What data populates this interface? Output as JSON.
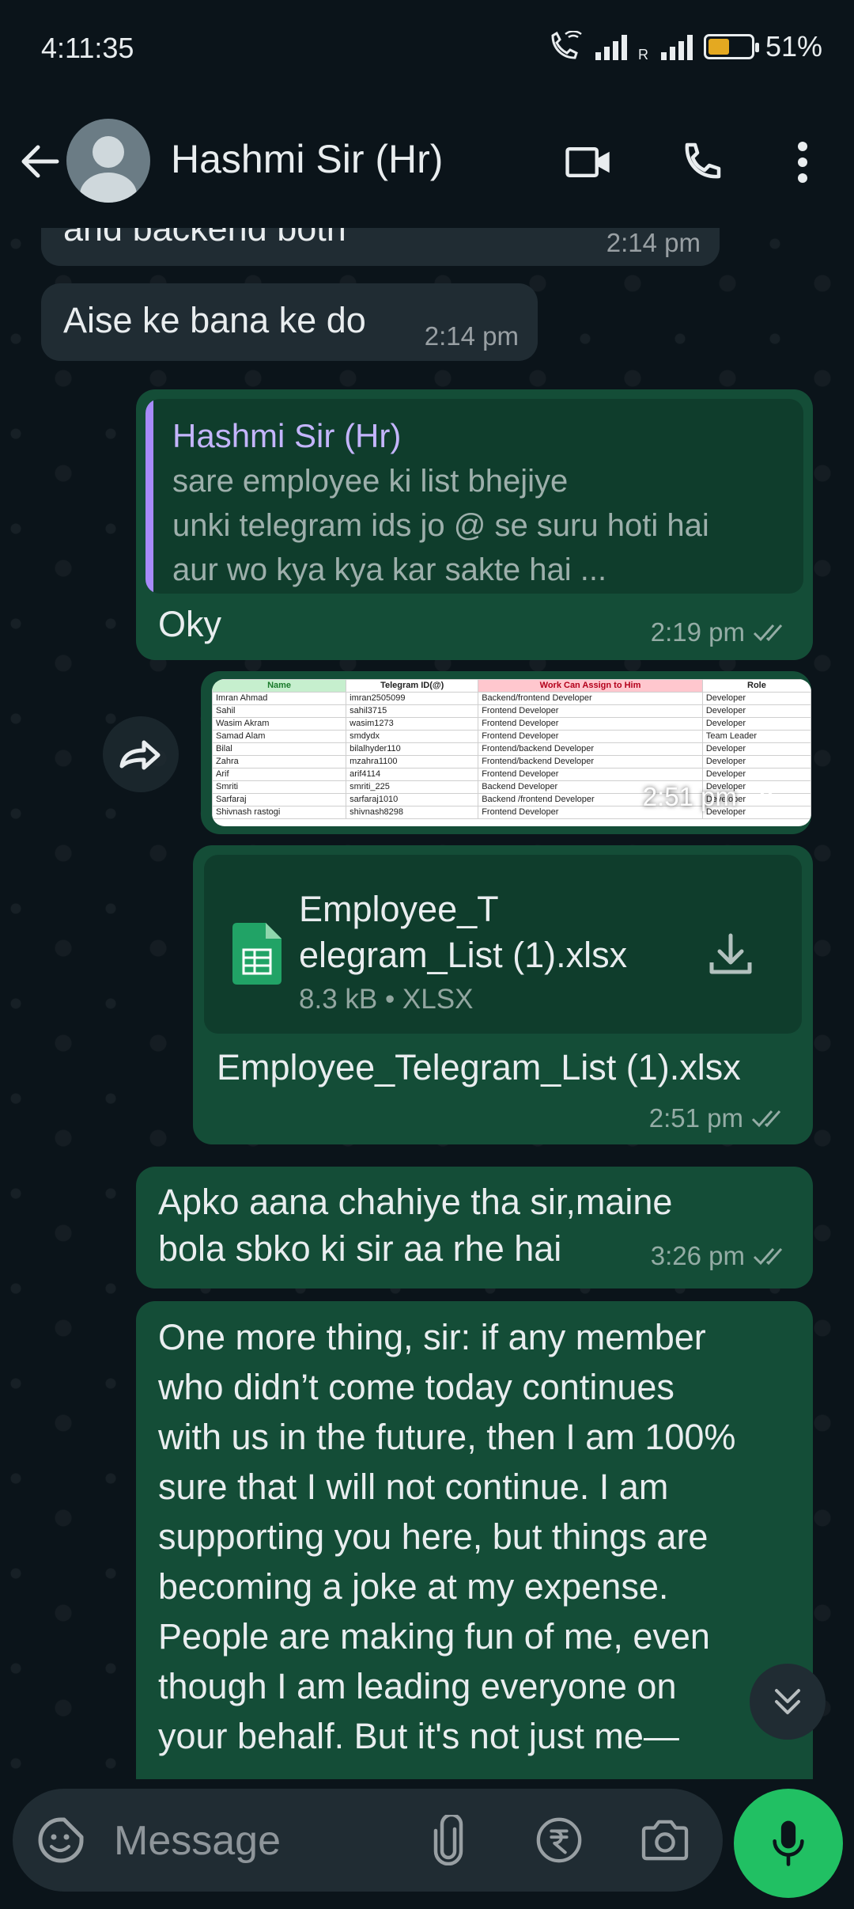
{
  "status_bar": {
    "time": "4:11:35",
    "battery": "51%",
    "roaming": "R",
    "battery_level": 0.51
  },
  "header": {
    "contact_name": "Hashmi Sir (Hr)"
  },
  "messages": {
    "m1": {
      "text": "and backend both",
      "time": "2:14 pm"
    },
    "m2": {
      "text": "Aise ke bana ke do",
      "time": "2:14 pm"
    },
    "m3": {
      "quote_name": "Hashmi Sir (Hr)",
      "quote_lines": [
        "sare employee ki list bhejiye",
        "unki telegram ids jo @ se suru hoti hai",
        "aur wo kya kya kar sakte hai ..."
      ],
      "text": "Oky",
      "time": "2:19 pm"
    },
    "m4": {
      "time": "2:51 pm"
    },
    "m5": {
      "file_name_line1": "Employee_T",
      "file_name_line2": "elegram_List (1).xlsx",
      "file_meta": "8.3 kB • XLSX",
      "caption": "Employee_Telegram_List (1).xlsx",
      "time": "2:51 pm"
    },
    "m6": {
      "line1": "Apko aana chahiye tha sir,maine",
      "line2": "bola sbko ki sir aa rhe hai",
      "time": "3:26 pm"
    },
    "m7": {
      "lines": [
        "One more thing, sir: if any member",
        "who didn’t come today continues",
        "with us in the future, then I am 100%",
        "sure that I will not continue. I am",
        "supporting you here, but things are",
        "becoming a joke at my expense.",
        "People are making fun of me, even",
        "though I am leading everyone on",
        "your behalf. But it's not just me—"
      ]
    }
  },
  "sheet": {
    "headers": [
      "Name",
      "Telegram ID(@)",
      "Work Can Assign to Him",
      "Role"
    ],
    "rows": [
      [
        "Imran Ahmad",
        "imran2505099",
        "Backend/frontend Developer",
        "Developer"
      ],
      [
        "Sahil",
        "sahil3715",
        "Frontend Developer",
        "Developer"
      ],
      [
        "Wasim Akram",
        "wasim1273",
        "Frontend Developer",
        "Developer"
      ],
      [
        "Samad Alam",
        "smdydx",
        "Frontend Developer",
        "Team Leader"
      ],
      [
        "Bilal",
        "bilalhyder110",
        "Frontend/backend Developer",
        "Developer"
      ],
      [
        "Zahra",
        "mzahra1100",
        "Frontend/backend Developer",
        "Developer"
      ],
      [
        "Arif",
        "arif4114",
        "Frontend Developer",
        "Developer"
      ],
      [
        "Smriti",
        "smriti_225",
        "Backend Developer",
        "Developer"
      ],
      [
        "Sarfaraj",
        "sarfaraj1010",
        "Backend /frontend Developer",
        "Developer"
      ],
      [
        "Shivnash rastogi",
        "shivnash8298",
        "Frontend Developer",
        "Developer"
      ]
    ]
  },
  "composer": {
    "placeholder": "Message"
  },
  "colors": {
    "background": "#0b141a",
    "incoming": "#202c33",
    "outgoing": "#144d37",
    "accent": "#21c063",
    "quote_bar": "#a78bfa"
  },
  "icons": [
    "back-arrow-icon",
    "avatar-icon",
    "video-call-icon",
    "phone-icon",
    "more-options-icon",
    "forward-icon",
    "spreadsheet-file-icon",
    "download-icon",
    "double-chevron-down-icon",
    "sticker-icon",
    "attachment-icon",
    "rupee-icon",
    "camera-icon",
    "microphone-icon"
  ]
}
